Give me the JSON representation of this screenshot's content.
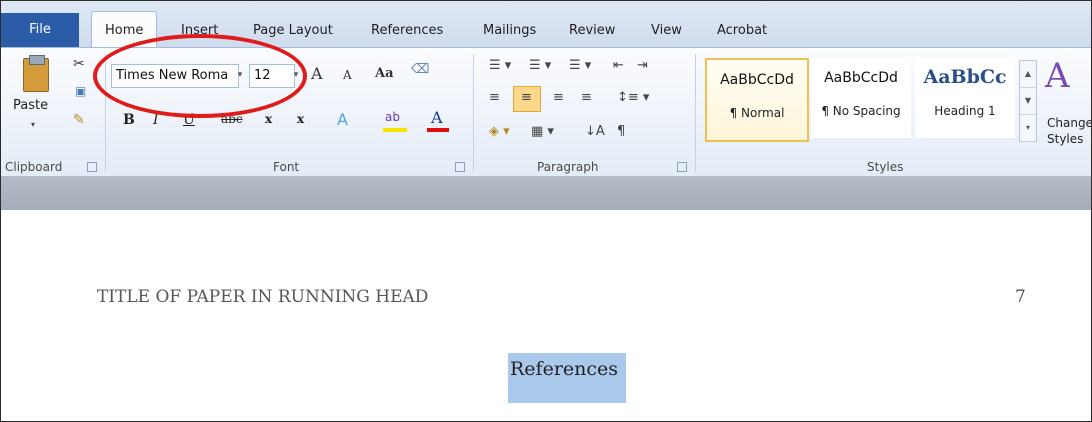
{
  "tabs": {
    "file": "File",
    "home": "Home",
    "insert": "Insert",
    "page_layout": "Page Layout",
    "references": "References",
    "mailings": "Mailings",
    "review": "Review",
    "view": "View",
    "acrobat": "Acrobat"
  },
  "clipboard": {
    "paste_label": "Paste",
    "group_label": "Clipboard"
  },
  "font": {
    "family": "Times New Roma",
    "size": "12",
    "group_label": "Font",
    "change_case": "Aa",
    "bold": "B",
    "italic": "I",
    "underline": "U",
    "strike": "abc",
    "subscript": "x",
    "superscript": "x",
    "font_color_letter": "A"
  },
  "paragraph": {
    "group_label": "Paragraph"
  },
  "styles": {
    "group_label": "Styles",
    "items": [
      {
        "sample": "AaBbCcDd",
        "name": "¶ Normal",
        "selected": true
      },
      {
        "sample": "AaBbCcDd",
        "name": "¶ No Spacing",
        "selected": false
      },
      {
        "sample": "AaBbCc",
        "name": "Heading 1",
        "selected": false
      }
    ],
    "change_label_1": "Change",
    "change_label_2": "Styles"
  },
  "document": {
    "running_head": "TITLE OF PAPER IN RUNNING HEAD",
    "page_number": "7",
    "heading": "References"
  },
  "colors": {
    "file_tab": "#2a5ca8",
    "annotation": "#e11a1a",
    "selection": "#aac8ec",
    "highlight_yellow": "#f7e400",
    "font_red": "#e01010"
  }
}
